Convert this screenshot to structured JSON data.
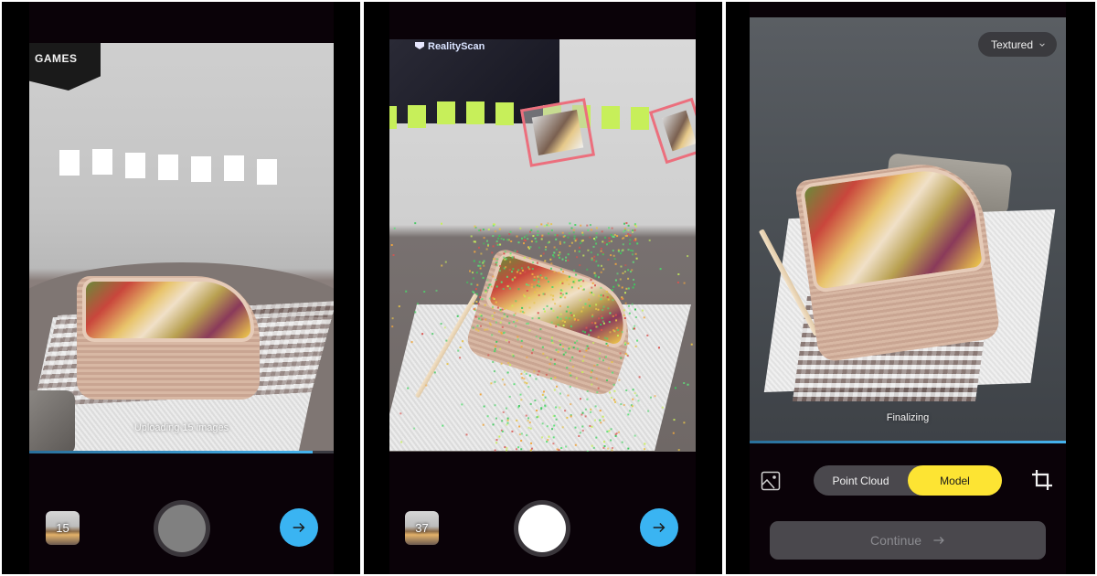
{
  "screens": [
    {
      "id": "capture-uploading",
      "status_text": "Uploading 15 images",
      "upload_progress_percent": 93,
      "thumbnail_count": "15",
      "shutter_state": "disabled",
      "wall_sign_text": "GAMES",
      "next_icon": "arrow-right-icon"
    },
    {
      "id": "capture-pointcloud",
      "tv_brand_text": "RealityScan",
      "thumbnail_count": "37",
      "shutter_state": "enabled",
      "next_icon": "arrow-right-icon"
    },
    {
      "id": "model-review",
      "view_mode_dropdown": "Textured",
      "status_text": "Finalizing",
      "processing_progress_percent": 100,
      "segmented": {
        "options": [
          "Point Cloud",
          "Model"
        ],
        "selected": "Model"
      },
      "continue_label": "Continue",
      "left_icon": "gallery-icon",
      "right_icon": "crop-icon"
    }
  ],
  "colors": {
    "accent_blue": "#3ab4f2",
    "accent_yellow": "#fde433",
    "marker_green": "#c7ef5a",
    "frame_pink": "#ec6f7d",
    "background": "#0a0208"
  }
}
